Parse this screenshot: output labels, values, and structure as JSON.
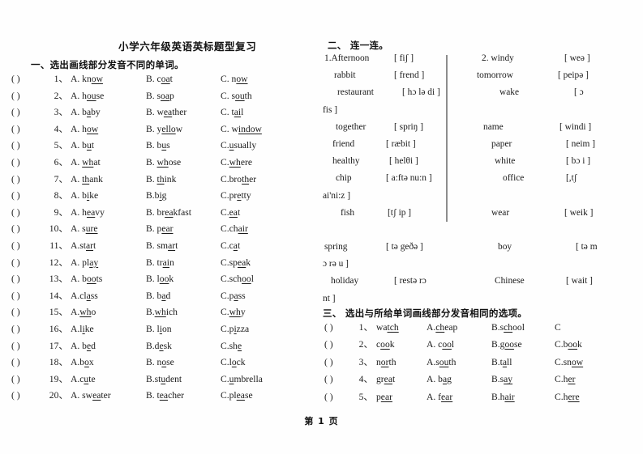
{
  "document": {
    "title": "小学六年级英语英标题型复习",
    "footer": "第 1 页",
    "ink_color": "#1b1b1b",
    "paper_color": "#fefefe",
    "divider_color": "#8d8d8d"
  },
  "section1": {
    "heading": "一、选出画线部分发音不同的单词。",
    "bracket": "(        )",
    "items": [
      {
        "num": "1、",
        "a_pre": "A. kn",
        "a_u": "ow",
        "a_post": "",
        "b_pre": "B. c",
        "b_u": "oa",
        "b_post": "t",
        "c_pre": "C. n",
        "c_u": "ow",
        "c_post": ""
      },
      {
        "num": "2、",
        "a_pre": "A. h",
        "a_u": "ou",
        "a_post": "se",
        "b_pre": "B. s",
        "b_u": "oa",
        "b_post": "p",
        "c_pre": "C. s",
        "c_u": "ou",
        "c_post": "th"
      },
      {
        "num": "3、",
        "a_pre": "A. b",
        "a_u": "a",
        "a_post": "by",
        "b_pre": "B. w",
        "b_u": "ea",
        "b_post": "ther",
        "c_pre": "C. t",
        "c_u": "ai",
        "c_post": "l"
      },
      {
        "num": "4、",
        "a_pre": "A. h",
        "a_u": "ow",
        "a_post": "",
        "b_pre": "B. y",
        "b_u": "ello",
        "b_post": "w",
        "c_pre": "C. w",
        "c_u": "indow",
        "c_post": ""
      },
      {
        "num": "5、",
        "a_pre": "A. b",
        "a_u": "u",
        "a_post": "t",
        "b_pre": "B. b",
        "b_u": "u",
        "b_post": "s",
        "c_pre": "C.",
        "c_u": "u",
        "c_post": "sually"
      },
      {
        "num": "6、",
        "a_pre": "A. ",
        "a_u": "wh",
        "a_post": "at",
        "b_pre": "B. ",
        "b_u": "wh",
        "b_post": "ose",
        "c_pre": "C.",
        "c_u": "wh",
        "c_post": "ere"
      },
      {
        "num": "7、",
        "a_pre": "A. ",
        "a_u": "th",
        "a_post": "ank",
        "b_pre": "B. ",
        "b_u": "th",
        "b_post": "ink",
        "c_pre": "C.bro",
        "c_u": "th",
        "c_post": "er"
      },
      {
        "num": "8、",
        "a_pre": "A. b",
        "a_u": "i",
        "a_post": "ke",
        "b_pre": "B.b",
        "b_u": "i",
        "b_post": "g",
        "c_pre": "C.pr",
        "c_u": "e",
        "c_post": "tty"
      },
      {
        "num": "9、",
        "a_pre": "A. h",
        "a_u": "ea",
        "a_post": "vy",
        "b_pre": "B. br",
        "b_u": "ea",
        "b_post": "kfast",
        "c_pre": "C.",
        "c_u": "ea",
        "c_post": "t"
      },
      {
        "num": "10、",
        "a_pre": "A. s",
        "a_u": "ure",
        "a_post": "",
        "b_pre": "B. p",
        "b_u": "ear",
        "b_post": "",
        "c_pre": "C.ch",
        "c_u": "air",
        "c_post": ""
      },
      {
        "num": "11、",
        "a_pre": "A.st",
        "a_u": "ar",
        "a_post": "t",
        "b_pre": "B. sm",
        "b_u": "ar",
        "b_post": "t",
        "c_pre": "C.c",
        "c_u": "a",
        "c_post": "t"
      },
      {
        "num": "12、",
        "a_pre": "A. pl",
        "a_u": "ay",
        "a_post": "",
        "b_pre": "B. tr",
        "b_u": "ai",
        "b_post": "n",
        "c_pre": "C.sp",
        "c_u": "ea",
        "c_post": "k"
      },
      {
        "num": "13、",
        "a_pre": "A. b",
        "a_u": "oo",
        "a_post": "ts",
        "b_pre": "B. l",
        "b_u": "oo",
        "b_post": "k",
        "c_pre": "C.sch",
        "c_u": "oo",
        "c_post": "l"
      },
      {
        "num": "14、",
        "a_pre": "A.cl",
        "a_u": "a",
        "a_post": "ss",
        "b_pre": "B. b",
        "b_u": "a",
        "b_post": "d",
        "c_pre": "C.p",
        "c_u": "a",
        "c_post": "ss"
      },
      {
        "num": "15、",
        "a_pre": "A.",
        "a_u": "wh",
        "a_post": "o",
        "b_pre": "B.",
        "b_u": "wh",
        "b_post": "ich",
        "c_pre": "C.",
        "c_u": "wh",
        "c_post": "y"
      },
      {
        "num": "16、",
        "a_pre": "A.l",
        "a_u": "i",
        "a_post": "ke",
        "b_pre": "B. l",
        "b_u": "i",
        "b_post": "on",
        "c_pre": "C.p",
        "c_u": "i",
        "c_post": "zza"
      },
      {
        "num": "17、",
        "a_pre": "A. b",
        "a_u": "e",
        "a_post": "d",
        "b_pre": "B.d",
        "b_u": "e",
        "b_post": "sk",
        "c_pre": "C.sh",
        "c_u": "e",
        "c_post": ""
      },
      {
        "num": "18、",
        "a_pre": "A.b",
        "a_u": "o",
        "a_post": "x",
        "b_pre": "B. n",
        "b_u": "o",
        "b_post": "se",
        "c_pre": "C.l",
        "c_u": "o",
        "c_post": "ck"
      },
      {
        "num": "19、",
        "a_pre": "A.c",
        "a_u": "u",
        "a_post": "te",
        "b_pre": "B.st",
        "b_u": "u",
        "b_post": "dent",
        "c_pre": "C.",
        "c_u": "u",
        "c_post": "mbrella"
      },
      {
        "num": "20、",
        "a_pre": "A. sw",
        "a_u": "ea",
        "a_post": "ter",
        "b_pre": "B. t",
        "b_u": "ea",
        "b_post": "cher",
        "c_pre": "C.pl",
        "c_u": "ea",
        "c_post": "se"
      }
    ]
  },
  "section2": {
    "heading": "二、 连一连。",
    "group1_label": "1.",
    "group2_label": "2.",
    "left_pairs": [
      {
        "word": "1.Afternoon",
        "phonetic": "[ fiʃ  ]"
      },
      {
        "word": "rabbit",
        "phonetic": "[ frend ]"
      },
      {
        "word": "restaurant",
        "phonetic": "[    hɔ lə di ]"
      },
      {
        "word": "fis ]",
        "phonetic": ""
      },
      {
        "word": "together",
        "phonetic": "[ spriŋ ]"
      },
      {
        "word": "friend",
        "phonetic": "[    ræbit ]"
      },
      {
        "word": "healthy",
        "phonetic": "[     helθi ]"
      },
      {
        "word": "chip",
        "phonetic": "[ a:ftə     nu:n ]"
      },
      {
        "word": "ai'ni:z ]",
        "phonetic": ""
      },
      {
        "word": "fish",
        "phonetic": "[tʃ ip ]"
      },
      {
        "word": "",
        "phonetic": ""
      },
      {
        "word": "spring",
        "phonetic": "[ tə     geðə ]"
      },
      {
        "word": "ɔ rə u ]",
        "phonetic": ""
      },
      {
        "word": "holiday",
        "phonetic": "[    restə rɔ"
      },
      {
        "word": "nt ]",
        "phonetic": ""
      }
    ],
    "right_pairs": [
      {
        "word": "2. windy",
        "phonetic": "[ weə  ]"
      },
      {
        "word": "tomorrow",
        "phonetic": "[     peipə  ]"
      },
      {
        "word": "wake",
        "phonetic": "[     ɔ"
      },
      {
        "word": "",
        "phonetic": ""
      },
      {
        "word": "name",
        "phonetic": "[    windi ]"
      },
      {
        "word": "paper",
        "phonetic": "[ neim ]"
      },
      {
        "word": "white",
        "phonetic": "[ bɔ i ]"
      },
      {
        "word": "office",
        "phonetic": "[,tʃ"
      },
      {
        "word": "",
        "phonetic": ""
      },
      {
        "word": "wear",
        "phonetic": "[ weik ]"
      },
      {
        "word": "",
        "phonetic": ""
      },
      {
        "word": "boy",
        "phonetic": "[ tə     m"
      },
      {
        "word": "",
        "phonetic": ""
      },
      {
        "word": "Chinese",
        "phonetic": "[ wait ]"
      },
      {
        "word": "",
        "phonetic": ""
      }
    ]
  },
  "section3": {
    "heading": "三、 选出与所给单词画线部分发音相同的选项。",
    "bracket": "(     )",
    "items": [
      {
        "num": "1、",
        "stem_pre": "wa",
        "stem_u": "tch",
        "stem_post": "",
        "a_pre": "A.",
        "a_u": "ch",
        "a_post": "eap",
        "b_pre": "B.s",
        "b_u": "ch",
        "b_post": "ool",
        "c_pre": "C",
        "c_u": "",
        "c_post": ""
      },
      {
        "num": "2、",
        "stem_pre": "c",
        "stem_u": "oo",
        "stem_post": "k",
        "a_pre": "A. c",
        "a_u": "oo",
        "a_post": "l",
        "b_pre": "B.g",
        "b_u": "oo",
        "b_post": "se",
        "c_pre": "C.b",
        "c_u": "oo",
        "c_post": "k"
      },
      {
        "num": "3、",
        "stem_pre": "n",
        "stem_u": "or",
        "stem_post": "th",
        "a_pre": "A.s",
        "a_u": "ou",
        "a_post": "th",
        "b_pre": "B.t",
        "b_u": "a",
        "b_post": "ll",
        "c_pre": "C.sn",
        "c_u": "ow",
        "c_post": ""
      },
      {
        "num": "4、",
        "stem_pre": "gr",
        "stem_u": "ea",
        "stem_post": "t",
        "a_pre": "A. b",
        "a_u": "a",
        "a_post": "g",
        "b_pre": "B.s",
        "b_u": "ay",
        "b_post": "",
        "c_pre": "C.h",
        "c_u": "er",
        "c_post": ""
      },
      {
        "num": "5、",
        "stem_pre": "p",
        "stem_u": "ear",
        "stem_post": "",
        "a_pre": "A. f",
        "a_u": "ear",
        "a_post": "",
        "b_pre": "B.h",
        "b_u": "air",
        "b_post": "",
        "c_pre": "C.h",
        "c_u": "ere",
        "c_post": ""
      }
    ]
  }
}
